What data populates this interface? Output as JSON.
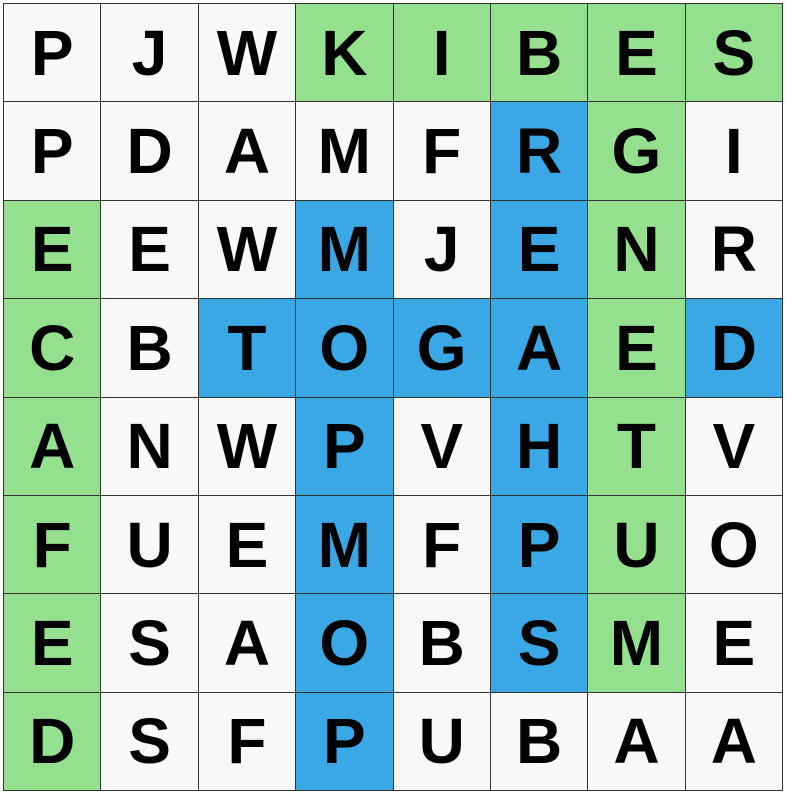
{
  "grid": {
    "rows": [
      [
        "P",
        "J",
        "W",
        "K",
        "I",
        "B",
        "E",
        "S"
      ],
      [
        "P",
        "D",
        "A",
        "M",
        "F",
        "R",
        "G",
        "I"
      ],
      [
        "E",
        "E",
        "W",
        "M",
        "J",
        "E",
        "N",
        "R"
      ],
      [
        "C",
        "B",
        "T",
        "O",
        "G",
        "A",
        "E",
        "D"
      ],
      [
        "A",
        "N",
        "W",
        "P",
        "V",
        "H",
        "T",
        "V"
      ],
      [
        "F",
        "U",
        "E",
        "M",
        "F",
        "P",
        "U",
        "O"
      ],
      [
        "E",
        "S",
        "A",
        "O",
        "B",
        "S",
        "M",
        "E"
      ],
      [
        "D",
        "S",
        "F",
        "P",
        "U",
        "B",
        "A",
        "A"
      ]
    ],
    "highlight": [
      [
        "n",
        "n",
        "n",
        "g",
        "g",
        "g",
        "g",
        "g"
      ],
      [
        "n",
        "n",
        "n",
        "n",
        "n",
        "b",
        "g",
        "n"
      ],
      [
        "g",
        "n",
        "n",
        "b",
        "n",
        "b",
        "g",
        "n"
      ],
      [
        "g",
        "n",
        "b",
        "b",
        "b",
        "b",
        "g",
        "b"
      ],
      [
        "g",
        "n",
        "n",
        "b",
        "n",
        "b",
        "g",
        "n"
      ],
      [
        "g",
        "n",
        "n",
        "b",
        "n",
        "b",
        "g",
        "n"
      ],
      [
        "g",
        "n",
        "n",
        "b",
        "n",
        "b",
        "g",
        "n"
      ],
      [
        "g",
        "n",
        "n",
        "b",
        "n",
        "n",
        "n",
        "n"
      ]
    ]
  },
  "colors": {
    "found_green": "#95e08e",
    "found_blue": "#3aa8e4",
    "empty": "#f8f8f8"
  }
}
